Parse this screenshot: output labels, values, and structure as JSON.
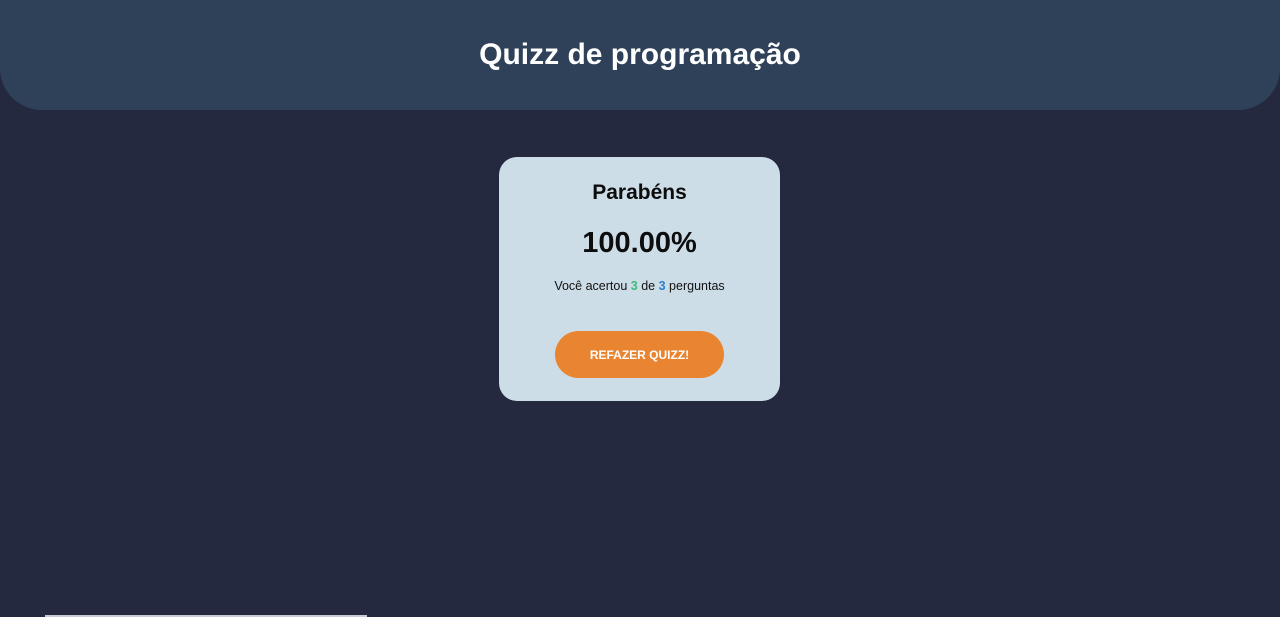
{
  "header": {
    "title": "Quizz de programação"
  },
  "result": {
    "title": "Parabéns",
    "score": "100.00%",
    "summary_prefix": "Você acertou",
    "correct": "3",
    "summary_middle": "de",
    "total": "3",
    "summary_suffix": "perguntas",
    "restart_label": "REFAZER QUIZZ!"
  },
  "colors": {
    "background": "#242940",
    "header": "#2e4159",
    "card": "#cddde8",
    "button": "#e98530",
    "correct": "#3dbb75",
    "total": "#2b7fd1"
  }
}
